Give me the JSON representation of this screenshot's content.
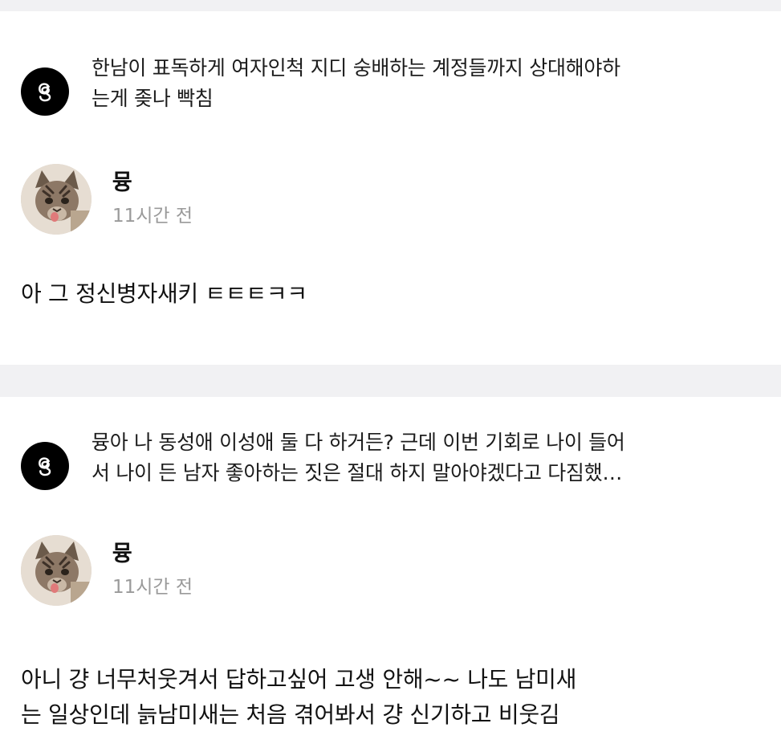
{
  "posts": [
    {
      "quote": "한남이 표독하게 여자인척 지디 숭배하는 계정들까지 상대해야하\n는게 좆나 빡침",
      "app_icon": "threads-logo-icon",
      "author": {
        "name": "뮹",
        "time": "11시간 전",
        "avatar": "cat-avatar-icon"
      },
      "reply": "아 그 정신병자새키 ㅌㅌㅌㅋㅋ"
    },
    {
      "quote": "뮹아 나 동성애 이성애 둘 다 하거든? 근데 이번 기회로 나이 들어\n서 나이 든 남자 좋아하는 짓은 절대 하지 말아야겠다고 다짐했…",
      "app_icon": "threads-logo-icon",
      "author": {
        "name": "뮹",
        "time": "11시간 전",
        "avatar": "cat-avatar-icon"
      },
      "reply": "아니 걍 너무처웃겨서 답하고싶어 고생 안해~~ 나도 남미새\n는 일상인데 늙남미새는 처음 겪어봐서 걍 신기하고 비웃김"
    }
  ],
  "colors": {
    "background": "#f1f1f3",
    "card": "#ffffff",
    "text": "#111111",
    "muted": "#9a9a9a"
  }
}
